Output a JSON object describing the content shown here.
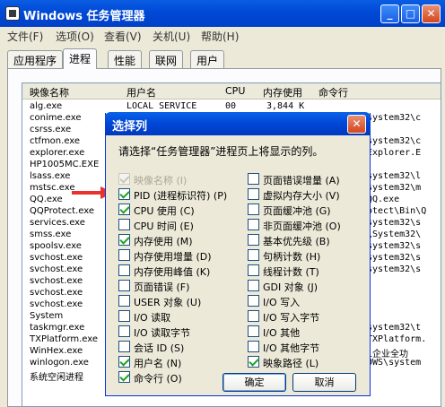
{
  "window": {
    "title": "Windows 任务管理器"
  },
  "menu": [
    "文件(F)",
    "选项(O)",
    "查看(V)",
    "关机(U)",
    "帮助(H)"
  ],
  "tabs": [
    "应用程序",
    "进程",
    "性能",
    "联网",
    "用户"
  ],
  "active_tab": "进程",
  "columns": [
    "映像名称",
    "用户名",
    "CPU",
    "内存使用",
    "命令行"
  ],
  "rows": [
    {
      "name": "alg.exe",
      "user": "LOCAL SERVICE",
      "cpu": "00",
      "mem": "3,844 K",
      "cmd": ""
    },
    {
      "name": "conime.exe",
      "user": "",
      "cpu": "",
      "mem": "",
      "cmd": "system32\\c"
    },
    {
      "name": "csrss.exe",
      "user": "",
      "cpu": "",
      "mem": "",
      "cmd": ""
    },
    {
      "name": "ctfmon.exe",
      "user": "",
      "cpu": "",
      "mem": "",
      "cmd": "system32\\c"
    },
    {
      "name": "explorer.exe",
      "user": "",
      "cpu": "",
      "mem": "",
      "cmd": "Explorer.E"
    },
    {
      "name": "HP1005MC.EXE",
      "user": "",
      "cpu": "",
      "mem": "",
      "cmd": ""
    },
    {
      "name": "lsass.exe",
      "user": "",
      "cpu": "",
      "mem": "",
      "cmd": "system32\\l"
    },
    {
      "name": "mstsc.exe",
      "user": "",
      "cpu": "",
      "mem": "",
      "cmd": "system32\\m"
    },
    {
      "name": "QQ.exe",
      "user": "",
      "cpu": "",
      "mem": "",
      "cmd": "QQ.exe"
    },
    {
      "name": "QQProtect.exe",
      "user": "",
      "cpu": "",
      "mem": "",
      "cmd": "otect\\Bin\\Q"
    },
    {
      "name": "services.exe",
      "user": "",
      "cpu": "",
      "mem": "",
      "cmd": "system32\\s"
    },
    {
      "name": "smss.exe",
      "user": "",
      "cpu": "",
      "mem": "",
      "cmd": "\\System32\\"
    },
    {
      "name": "spoolsv.exe",
      "user": "",
      "cpu": "",
      "mem": "",
      "cmd": "system32\\s"
    },
    {
      "name": "svchost.exe",
      "user": "",
      "cpu": "",
      "mem": "",
      "cmd": "system32\\s"
    },
    {
      "name": "svchost.exe",
      "user": "",
      "cpu": "",
      "mem": "",
      "cmd": "system32\\s"
    },
    {
      "name": "svchost.exe",
      "user": "",
      "cpu": "",
      "mem": "",
      "cmd": ""
    },
    {
      "name": "svchost.exe",
      "user": "",
      "cpu": "",
      "mem": "",
      "cmd": ""
    },
    {
      "name": "svchost.exe",
      "user": "",
      "cpu": "",
      "mem": "",
      "cmd": ""
    },
    {
      "name": "System",
      "user": "",
      "cpu": "",
      "mem": "",
      "cmd": ""
    },
    {
      "name": "taskmgr.exe",
      "user": "",
      "cpu": "",
      "mem": "",
      "cmd": "system32\\t"
    },
    {
      "name": "TXPlatform.exe",
      "user": "",
      "cpu": "",
      "mem": "",
      "cmd": "TXPlatform."
    },
    {
      "name": "WinHex.exe",
      "user": "",
      "cpu": "",
      "mem": "",
      "cmd": "1企业全功"
    },
    {
      "name": "winlogon.exe",
      "user": "",
      "cpu": "",
      "mem": "",
      "cmd": "OWS\\system"
    },
    {
      "name": "系统空闲进程",
      "user": "",
      "cpu": "",
      "mem": "",
      "cmd": ""
    }
  ],
  "dialog": {
    "title": "选择列",
    "prompt": "请选择“任务管理器”进程页上将显示的列。",
    "ok": "确定",
    "cancel": "取消",
    "left_options": [
      {
        "label": "映像名称 (I)",
        "checked": true,
        "disabled": true
      },
      {
        "label": "PID (进程标识符) (P)",
        "checked": true,
        "disabled": false
      },
      {
        "label": "CPU 使用 (C)",
        "checked": true,
        "disabled": false
      },
      {
        "label": "CPU 时间 (E)",
        "checked": false,
        "disabled": false
      },
      {
        "label": "内存使用 (M)",
        "checked": true,
        "disabled": false
      },
      {
        "label": "内存使用增量 (D)",
        "checked": false,
        "disabled": false
      },
      {
        "label": "内存使用峰值 (K)",
        "checked": false,
        "disabled": false
      },
      {
        "label": "页面错误 (F)",
        "checked": false,
        "disabled": false
      },
      {
        "label": "USER 对象 (U)",
        "checked": false,
        "disabled": false
      },
      {
        "label": "I/O 读取",
        "checked": false,
        "disabled": false
      },
      {
        "label": "I/O 读取字节",
        "checked": false,
        "disabled": false
      },
      {
        "label": "会话 ID (S)",
        "checked": false,
        "disabled": false
      },
      {
        "label": "用户名 (N)",
        "checked": true,
        "disabled": false
      },
      {
        "label": "命令行 (O)",
        "checked": true,
        "disabled": false
      }
    ],
    "right_options": [
      {
        "label": "页面错误增量 (A)",
        "checked": false
      },
      {
        "label": "虚拟内存大小 (V)",
        "checked": false
      },
      {
        "label": "页面缓冲池 (G)",
        "checked": false
      },
      {
        "label": "非页面缓冲池 (O)",
        "checked": false
      },
      {
        "label": "基本优先级 (B)",
        "checked": false
      },
      {
        "label": "句柄计数 (H)",
        "checked": false
      },
      {
        "label": "线程计数 (T)",
        "checked": false
      },
      {
        "label": "GDI 对象 (J)",
        "checked": false
      },
      {
        "label": "I/O 写入",
        "checked": false
      },
      {
        "label": "I/O 写入字节",
        "checked": false
      },
      {
        "label": "I/O 其他",
        "checked": false
      },
      {
        "label": "I/O 其他字节",
        "checked": false
      },
      {
        "label": "映象路径 (L)",
        "checked": true
      }
    ]
  },
  "colors": {
    "titlebar": "#0049D6",
    "face": "#ECE9D8",
    "arrow": "#E8332C",
    "check": "#21A121"
  }
}
